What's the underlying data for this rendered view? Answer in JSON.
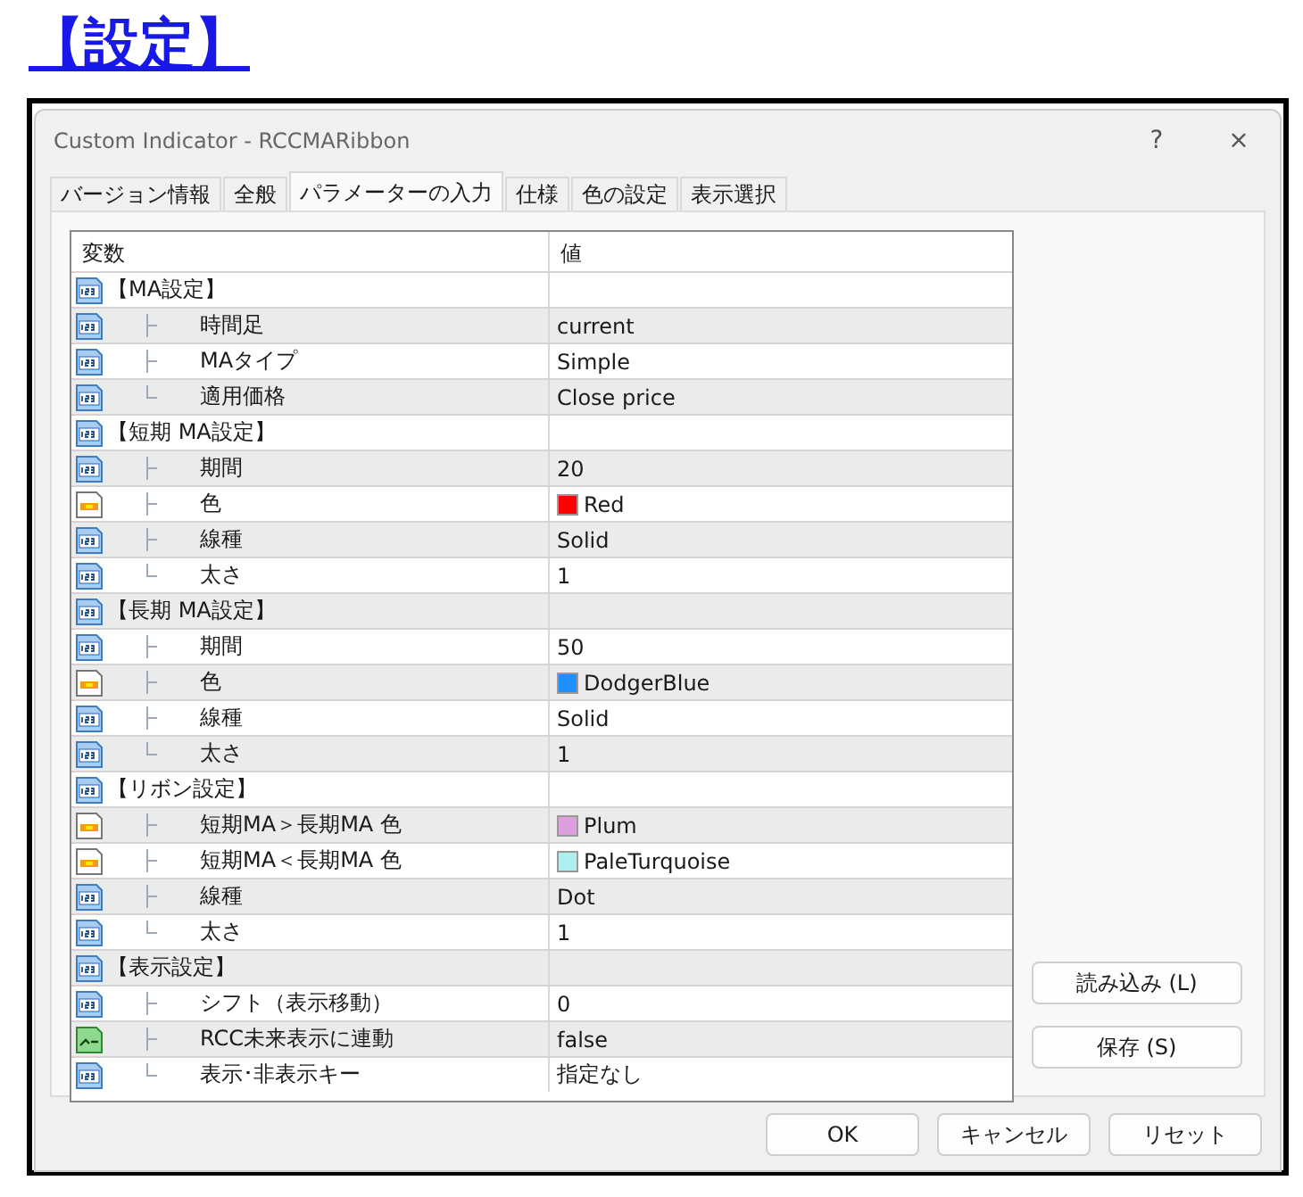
{
  "heading": "【設定】",
  "window": {
    "title": "Custom Indicator - RCCMARibbon",
    "help": "?",
    "close": "×"
  },
  "tabs": [
    {
      "label": "バージョン情報",
      "selected": false
    },
    {
      "label": "全般",
      "selected": false
    },
    {
      "label": "パラメーターの入力",
      "selected": true
    },
    {
      "label": "仕様",
      "selected": false
    },
    {
      "label": "色の設定",
      "selected": false
    },
    {
      "label": "表示選択",
      "selected": false
    }
  ],
  "table": {
    "columns": [
      "変数",
      "値"
    ],
    "rows": [
      {
        "label": "【MA設定】",
        "kind": "number",
        "children": [
          {
            "label": "時間足",
            "kind": "number",
            "value": "current"
          },
          {
            "label": "MAタイプ",
            "kind": "number",
            "value": "Simple"
          },
          {
            "label": "適用価格",
            "kind": "number",
            "value": "Close price"
          }
        ]
      },
      {
        "label": "【短期 MA設定】",
        "kind": "number",
        "children": [
          {
            "label": "期間",
            "kind": "number",
            "value": "20"
          },
          {
            "label": "色",
            "kind": "color",
            "value": "Red",
            "color": "#ff0000"
          },
          {
            "label": "線種",
            "kind": "number",
            "value": "Solid"
          },
          {
            "label": "太さ",
            "kind": "number",
            "value": "1"
          }
        ]
      },
      {
        "label": "【長期 MA設定】",
        "kind": "number",
        "children": [
          {
            "label": "期間",
            "kind": "number",
            "value": "50"
          },
          {
            "label": "色",
            "kind": "color",
            "value": "DodgerBlue",
            "color": "#1e90ff"
          },
          {
            "label": "線種",
            "kind": "number",
            "value": "Solid"
          },
          {
            "label": "太さ",
            "kind": "number",
            "value": "1"
          }
        ]
      },
      {
        "label": "【リボン設定】",
        "kind": "number",
        "children": [
          {
            "label": "短期MA＞長期MA 色",
            "kind": "color",
            "value": "Plum",
            "color": "#dda0dd"
          },
          {
            "label": "短期MA＜長期MA 色",
            "kind": "color",
            "value": "PaleTurquoise",
            "color": "#afeeee"
          },
          {
            "label": "線種",
            "kind": "number",
            "value": "Dot"
          },
          {
            "label": "太さ",
            "kind": "number",
            "value": "1"
          }
        ]
      },
      {
        "label": "【表示設定】",
        "kind": "number",
        "children": [
          {
            "label": "シフト（表示移動）",
            "kind": "number",
            "value": "0"
          },
          {
            "label": "RCC未来表示に連動",
            "kind": "bool",
            "value": "false"
          },
          {
            "label": "表示･非表示キー",
            "kind": "number",
            "value": "指定なし"
          }
        ]
      }
    ]
  },
  "side_buttons": [
    "読み込み (L)",
    "保存 (S)"
  ],
  "buttons": [
    "OK",
    "キャンセル",
    "リセット"
  ]
}
